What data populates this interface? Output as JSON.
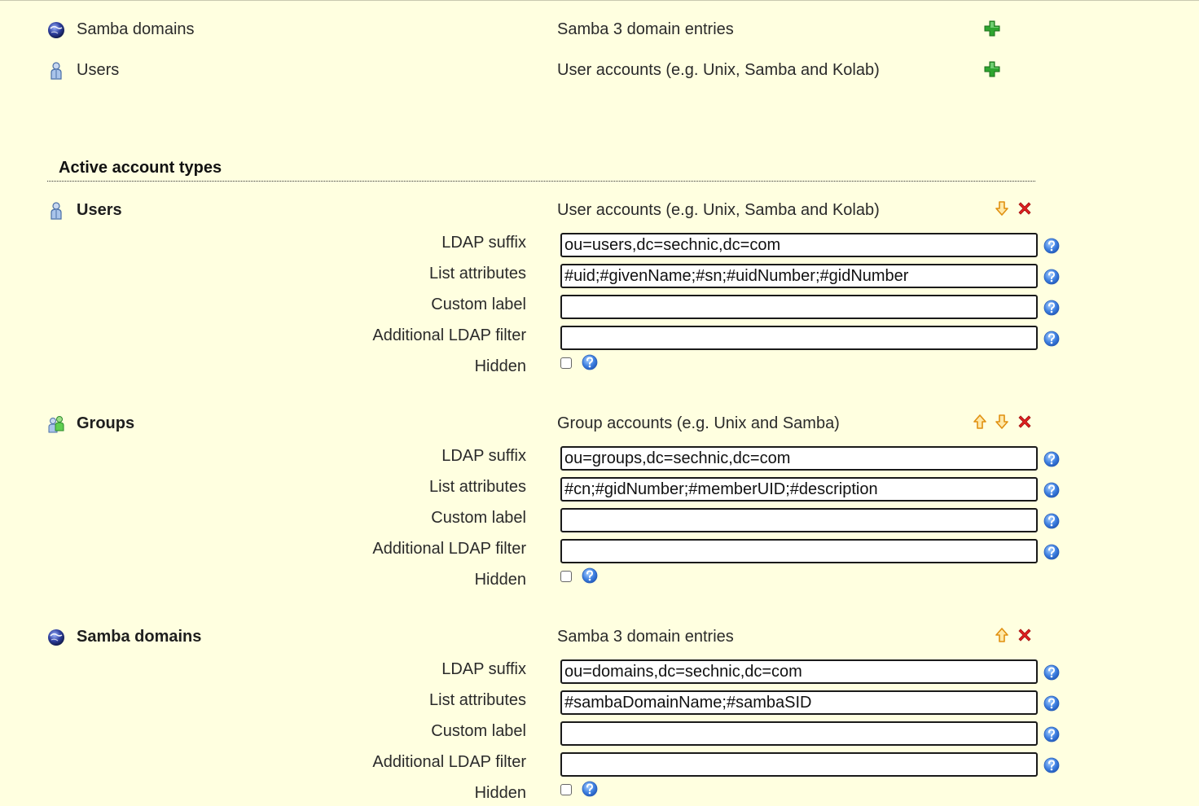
{
  "available_types": [
    {
      "name": "Samba domains",
      "description": "Samba 3 domain entries",
      "icon": "samba-domain-icon"
    },
    {
      "name": "Users",
      "description": "User accounts (e.g. Unix, Samba and Kolab)",
      "icon": "user-icon"
    }
  ],
  "active_section": {
    "title": "Active account types"
  },
  "field_labels": {
    "ldap_suffix": "LDAP suffix",
    "list_attributes": "List attributes",
    "custom_label": "Custom label",
    "additional_filter": "Additional LDAP filter",
    "hidden": "Hidden"
  },
  "active_types": [
    {
      "name": "Users",
      "description": "User accounts (e.g. Unix, Samba and Kolab)",
      "icon": "user-icon",
      "ldap_suffix": "ou=users,dc=sechnic,dc=com",
      "list_attributes": "#uid;#givenName;#sn;#uidNumber;#gidNumber",
      "custom_label": "",
      "additional_filter": "",
      "hidden": false
    },
    {
      "name": "Groups",
      "description": "Group accounts (e.g. Unix and Samba)",
      "icon": "group-icon",
      "ldap_suffix": "ou=groups,dc=sechnic,dc=com",
      "list_attributes": "#cn;#gidNumber;#memberUID;#description",
      "custom_label": "",
      "additional_filter": "",
      "hidden": false
    },
    {
      "name": "Samba domains",
      "description": "Samba 3 domain entries",
      "icon": "samba-domain-icon",
      "ldap_suffix": "ou=domains,dc=sechnic,dc=com",
      "list_attributes": "#sambaDomainName;#sambaSID",
      "custom_label": "",
      "additional_filter": "",
      "hidden": false
    }
  ],
  "colors": {
    "background": "#ffffe0",
    "add": "#2fa52f",
    "delete": "#e02020",
    "arrow": "#f0a020",
    "help": "#3d7fe0"
  }
}
